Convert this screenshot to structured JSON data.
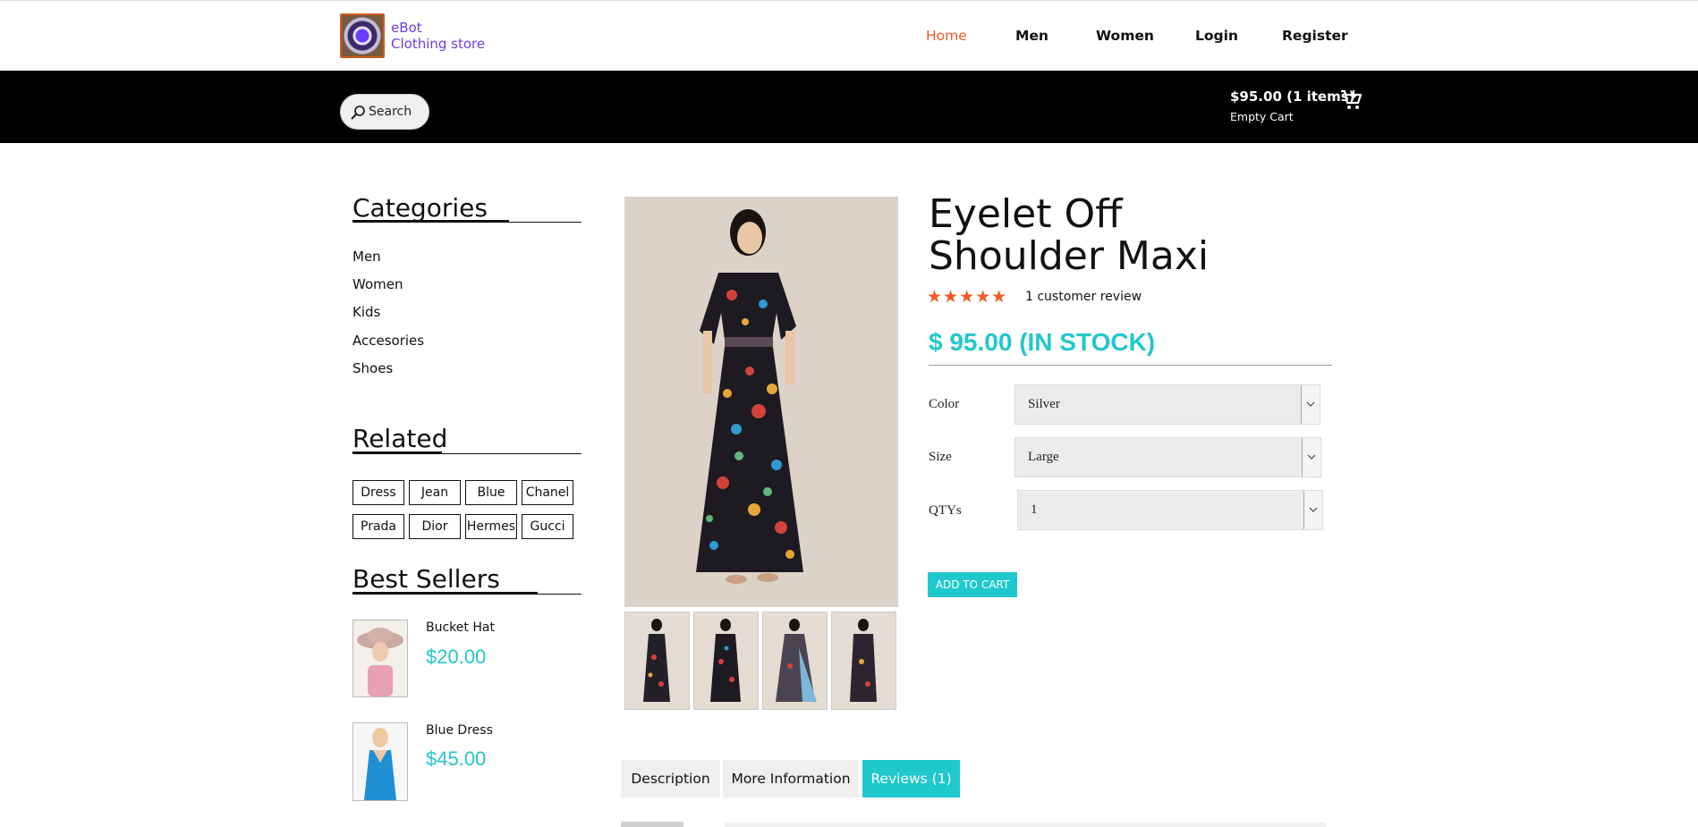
{
  "brand": {
    "line1": "eBot",
    "line2": "Clothing store",
    "icon": "logo-icon"
  },
  "nav": {
    "home": "Home",
    "men": "Men",
    "women": "Women",
    "login": "Login",
    "register": "Register"
  },
  "toolbar": {
    "search_label": "Search",
    "cart_total": "$95.00 (1 items)",
    "cart_empty": "Empty Cart"
  },
  "sidebar": {
    "categories_title": "Categories",
    "categories": [
      "Men",
      "Women",
      "Kids",
      "Accesories",
      "Shoes"
    ],
    "related_title": "Related",
    "tags": [
      "Dress",
      "Jean",
      "Blue",
      "Chanel",
      "Prada",
      "Dior",
      "Hermes",
      "Gucci"
    ],
    "best_title": "Best Sellers",
    "best": [
      {
        "name": "Bucket Hat",
        "price": "$20.00"
      },
      {
        "name": "Blue Dress",
        "price": "$45.00"
      }
    ]
  },
  "product": {
    "title": "Eyelet Off Shoulder Maxi",
    "stars": "★★★★★",
    "rating": 5,
    "reviews": "1 customer review",
    "price": "$ 95.00 (IN STOCK)",
    "options": {
      "color_label": "Color",
      "color_value": "Silver",
      "size_label": "Size",
      "size_value": "Large",
      "qty_label": "QTYs",
      "qty_value": "1"
    },
    "add_to_cart": "ADD TO CART"
  },
  "tabs": {
    "description": "Description",
    "more_info": "More Information",
    "reviews": "Reviews (1)"
  },
  "colors": {
    "accent": "#1fc8cc",
    "nav_active": "#f05a28",
    "brand": "#6a3ee0"
  }
}
